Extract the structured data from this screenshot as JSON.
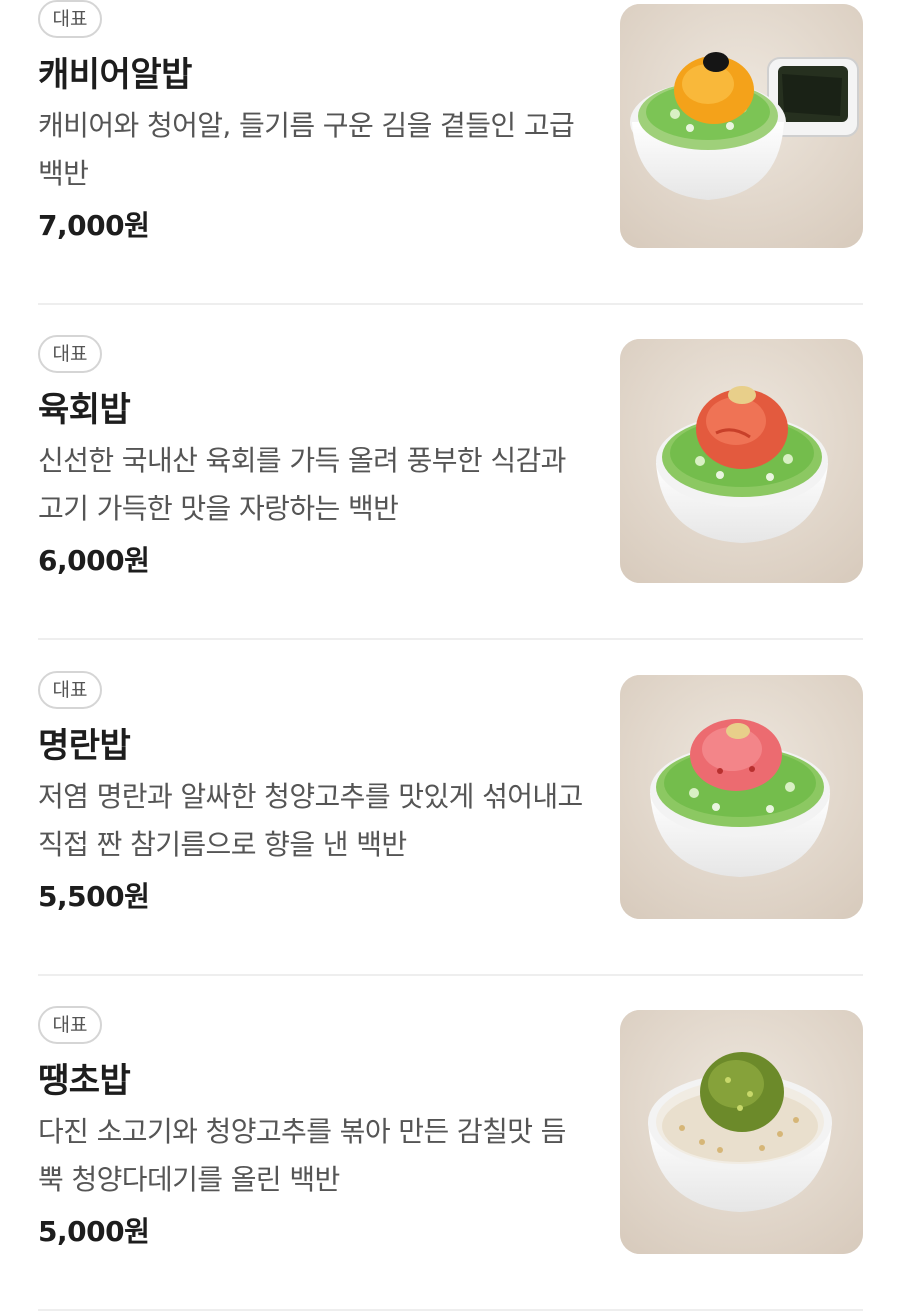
{
  "menu": {
    "items": [
      {
        "badge": "대표",
        "name": "캐비어알밥",
        "description": "캐비어와 청어알, 들기름 구운 김을 곁들인 고급 백반",
        "price": "7,000원",
        "image": "caviar-roe-rice-bowl-with-seaweed"
      },
      {
        "badge": "대표",
        "name": "육회밥",
        "description": "신선한 국내산 육회를 가득 올려 풍부한 식감과 고기 가득한 맛을 자랑하는 백반",
        "price": "6,000원",
        "image": "yukhoe-rice-bowl"
      },
      {
        "badge": "대표",
        "name": "명란밥",
        "description": "저염 명란과 알싸한 청양고추를 맛있게 섞어내고 직접 짠 참기름으로 향을 낸 백반",
        "price": "5,500원",
        "image": "myeongran-rice-bowl"
      },
      {
        "badge": "대표",
        "name": "땡초밥",
        "description": "다진 소고기와 청양고추를 볶아 만든 감칠맛 듬뿍 청양다데기를 올린 백반",
        "price": "5,000원",
        "image": "ttaengcho-rice-bowl"
      }
    ]
  },
  "colors": {
    "badge_border": "#d5d5d5",
    "text_primary": "#1d1d1d",
    "text_secondary": "#555555",
    "divider": "#eeeeee",
    "thumb_background": "#e7ddd2"
  }
}
